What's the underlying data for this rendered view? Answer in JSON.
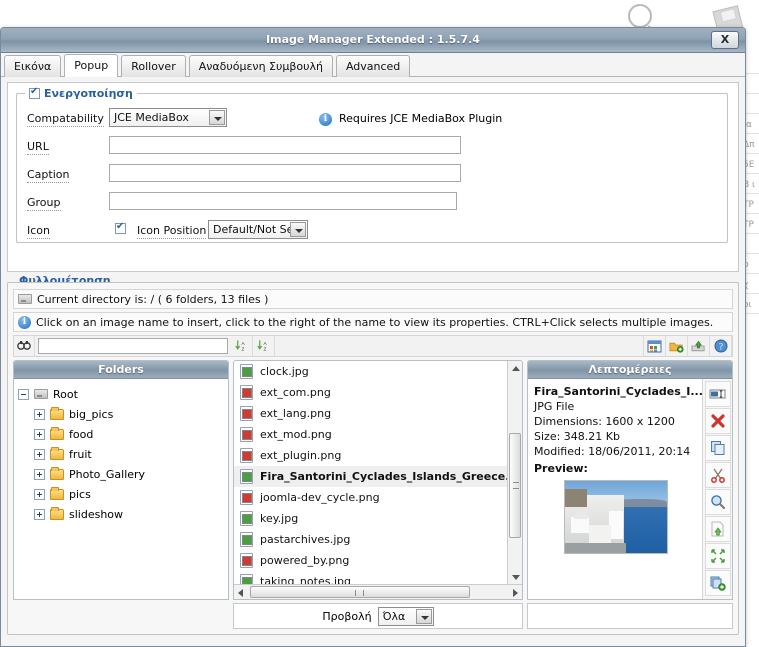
{
  "background": {
    "icons": [
      "magnifier-icon",
      "floppy-disk-icon"
    ],
    "side_texts": [
      "",
      "",
      "",
      "ια",
      "Δπ",
      "5Ε",
      "Β ι",
      "ΤΡ",
      "ΤΡ",
      "",
      "ρ",
      "χ",
      "οι"
    ]
  },
  "dialog": {
    "title": "Image Manager Extended : 1.5.7.4",
    "close_label": "X"
  },
  "tabs": [
    {
      "label": "Εικόνα",
      "active": false
    },
    {
      "label": "Popup",
      "active": true
    },
    {
      "label": "Rollover",
      "active": false
    },
    {
      "label": "Αναδυόμενη Συμβουλή",
      "active": false
    },
    {
      "label": "Advanced",
      "active": false
    }
  ],
  "popup_form": {
    "legend": "Ενεργοποίηση",
    "legend_checked": true,
    "compatability": {
      "label": "Compatability",
      "value": "JCE MediaBox",
      "options": [
        "JCE MediaBox"
      ]
    },
    "plugin_note": "Requires JCE MediaBox Plugin",
    "url": {
      "label": "URL",
      "value": "",
      "placeholder": ""
    },
    "caption": {
      "label": "Caption",
      "value": "",
      "placeholder": ""
    },
    "group": {
      "label": "Group",
      "value": "",
      "placeholder": ""
    },
    "icon": {
      "label": "Icon",
      "checked": true
    },
    "icon_position": {
      "label": "Icon Position",
      "value": "Default/Not Set",
      "options": [
        "Default/Not Set"
      ]
    }
  },
  "browse": {
    "legend": "Φυλλομέτρηση",
    "current_directory": "Current directory is: / ( 6 folders, 13 files )",
    "hint": "Click on an image name to insert, click to the right of the name to view its properties. CTRL+Click selects multiple images.",
    "search_value": "",
    "search_placeholder": "",
    "toolbar_left": [
      "search-binoculars-icon",
      "sort-az-ascending-icon",
      "sort-az-descending-icon"
    ],
    "toolbar_right": [
      "thumbnail-view-icon",
      "new-folder-icon",
      "upload-icon",
      "help-icon"
    ]
  },
  "folders_pane": {
    "title": "Folders",
    "root": {
      "label": "Root",
      "expanded": true
    },
    "items": [
      {
        "label": "big_pics"
      },
      {
        "label": "food"
      },
      {
        "label": "fruit"
      },
      {
        "label": "Photo_Gallery"
      },
      {
        "label": "pics"
      },
      {
        "label": "slideshow"
      }
    ]
  },
  "files": [
    {
      "name": "clock.jpg",
      "type": "jpg",
      "selected": false
    },
    {
      "name": "ext_com.png",
      "type": "png",
      "selected": false
    },
    {
      "name": "ext_lang.png",
      "type": "png",
      "selected": false
    },
    {
      "name": "ext_mod.png",
      "type": "png",
      "selected": false
    },
    {
      "name": "ext_plugin.png",
      "type": "png",
      "selected": false
    },
    {
      "name": "Fira_Santorini_Cyclades_Islands_Greece.jpg",
      "type": "jpg",
      "selected": true
    },
    {
      "name": "joomla-dev_cycle.png",
      "type": "png",
      "selected": false
    },
    {
      "name": "key.jpg",
      "type": "jpg",
      "selected": false
    },
    {
      "name": "pastarchives.jpg",
      "type": "jpg",
      "selected": false
    },
    {
      "name": "powered_by.png",
      "type": "png",
      "selected": false
    },
    {
      "name": "taking_notes.jpg",
      "type": "jpg",
      "selected": false
    }
  ],
  "details": {
    "title": "Λεπτομέρειες",
    "filename": "Fira_Santorini_Cyclades_I...",
    "filetype": "JPG File",
    "dimensions": "Dimensions: 1600 x 1200",
    "size": "Size: 348.21 Kb",
    "modified": "Modified: 18/06/2011, 20:14",
    "preview_label": "Preview:",
    "tools": [
      "rename-icon",
      "delete-icon",
      "copy-icon",
      "cut-icon",
      "view-icon",
      "upload-file-icon",
      "resize-icon",
      "paste-icon"
    ]
  },
  "footer": {
    "view_label": "Προβολή",
    "view_value": "Όλα",
    "view_options": [
      "Όλα"
    ]
  },
  "colors": {
    "titlebar": "#8fa2b4",
    "legend_text": "#2b5fa3",
    "pane_header": "#8195a8",
    "selected_row": "#efefef"
  }
}
